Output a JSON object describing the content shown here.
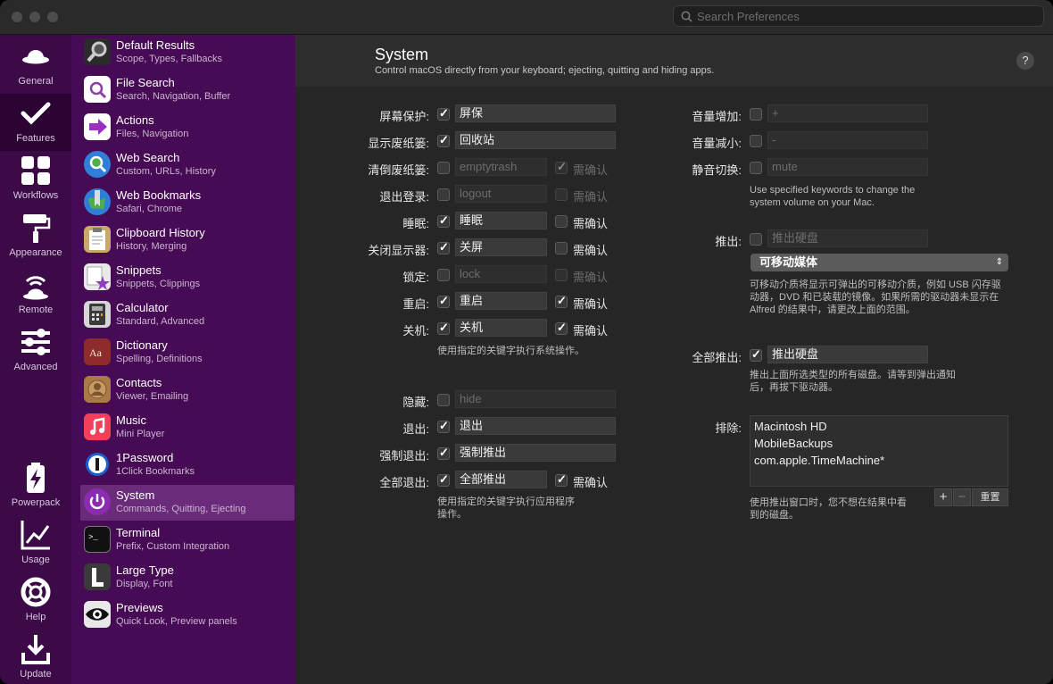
{
  "search": {
    "placeholder": "Search Preferences"
  },
  "leftbar": [
    {
      "label": "General",
      "icon": "hat-icon"
    },
    {
      "label": "Features",
      "icon": "checkmark-icon"
    },
    {
      "label": "Workflows",
      "icon": "grid-icon"
    },
    {
      "label": "Appearance",
      "icon": "paint-roller-icon"
    },
    {
      "label": "Remote",
      "icon": "remote-icon"
    },
    {
      "label": "Advanced",
      "icon": "sliders-icon"
    },
    {
      "label": "Powerpack",
      "icon": "battery-icon"
    },
    {
      "label": "Usage",
      "icon": "chart-icon"
    },
    {
      "label": "Help",
      "icon": "lifebuoy-icon"
    },
    {
      "label": "Update",
      "icon": "download-icon"
    }
  ],
  "features": [
    {
      "title": "Default Results",
      "subtitle": "Scope, Types, Fallbacks",
      "icon": "magnifier-icon"
    },
    {
      "title": "File Search",
      "subtitle": "Search, Navigation, Buffer",
      "icon": "file-search-icon"
    },
    {
      "title": "Actions",
      "subtitle": "Files, Navigation",
      "icon": "actions-arrow-icon"
    },
    {
      "title": "Web Search",
      "subtitle": "Custom, URLs, History",
      "icon": "globe-search-icon"
    },
    {
      "title": "Web Bookmarks",
      "subtitle": "Safari, Chrome",
      "icon": "globe-bookmark-icon"
    },
    {
      "title": "Clipboard History",
      "subtitle": "History, Merging",
      "icon": "clipboard-icon"
    },
    {
      "title": "Snippets",
      "subtitle": "Snippets, Clippings",
      "icon": "snippets-icon"
    },
    {
      "title": "Calculator",
      "subtitle": "Standard, Advanced",
      "icon": "calculator-icon"
    },
    {
      "title": "Dictionary",
      "subtitle": "Spelling, Definitions",
      "icon": "dictionary-icon"
    },
    {
      "title": "Contacts",
      "subtitle": "Viewer, Emailing",
      "icon": "contacts-icon"
    },
    {
      "title": "Music",
      "subtitle": "Mini Player",
      "icon": "music-icon"
    },
    {
      "title": "1Password",
      "subtitle": "1Click Bookmarks",
      "icon": "1password-icon"
    },
    {
      "title": "System",
      "subtitle": "Commands, Quitting, Ejecting",
      "icon": "power-icon"
    },
    {
      "title": "Terminal",
      "subtitle": "Prefix, Custom Integration",
      "icon": "terminal-icon"
    },
    {
      "title": "Large Type",
      "subtitle": "Display, Font",
      "icon": "large-type-icon"
    },
    {
      "title": "Previews",
      "subtitle": "Quick Look, Preview panels",
      "icon": "eye-icon"
    }
  ],
  "header": {
    "title": "System",
    "subtitle": "Control macOS directly from your keyboard; ejecting, quitting and hiding apps."
  },
  "confirm_label": "需确认",
  "system_rows": [
    {
      "label": "屏幕保护:",
      "checked": true,
      "value": "屏保",
      "confirm": null
    },
    {
      "label": "显示废纸篓:",
      "checked": true,
      "value": "回收站",
      "confirm": null
    },
    {
      "label": "清倒废纸篓:",
      "checked": false,
      "value": "emptytrash",
      "confirm": true
    },
    {
      "label": "退出登录:",
      "checked": false,
      "value": "logout",
      "confirm": false
    },
    {
      "label": "睡眠:",
      "checked": true,
      "value": "睡眠",
      "confirm": false
    },
    {
      "label": "关闭显示器:",
      "checked": true,
      "value": "关屏",
      "confirm": false
    },
    {
      "label": "锁定:",
      "checked": false,
      "value": "lock",
      "confirm": false
    },
    {
      "label": "重启:",
      "checked": true,
      "value": "重启",
      "confirm": true
    },
    {
      "label": "关机:",
      "checked": true,
      "value": "关机",
      "confirm": true
    }
  ],
  "system_note": "使用指定的关键字执行系统操作。",
  "app_rows": [
    {
      "label": "隐藏:",
      "checked": false,
      "value": "hide",
      "confirm": null
    },
    {
      "label": "退出:",
      "checked": true,
      "value": "退出",
      "confirm": null
    },
    {
      "label": "强制退出:",
      "checked": true,
      "value": "强制推出",
      "confirm": null
    },
    {
      "label": "全部退出:",
      "checked": true,
      "value": "全部推出",
      "confirm": true
    }
  ],
  "app_note": [
    "使用指定的关键字执行应用程序",
    "操作。"
  ],
  "volume_rows": [
    {
      "label": "音量增加:",
      "checked": false,
      "value": "+"
    },
    {
      "label": "音量减小:",
      "checked": false,
      "value": "-"
    },
    {
      "label": "静音切换:",
      "checked": false,
      "value": "mute"
    }
  ],
  "volume_note": [
    "Use specified keywords to change the",
    "system volume on your Mac."
  ],
  "eject": {
    "label": "推出:",
    "checked": false,
    "value": "推出硬盘",
    "popup": "可移动媒体",
    "note": [
      "可移动介质将显示可弹出的可移动介质，例如 USB 闪存驱",
      "动器，DVD 和已装载的镜像。如果所需的驱动器未显示在",
      "Alfred 的结果中，请更改上面的范围。"
    ]
  },
  "eject_all": {
    "label": "全部推出:",
    "checked": true,
    "value": "推出硬盘",
    "note": [
      "推出上面所选类型的所有磁盘。请等到弹出通知",
      "后，再拔下驱动器。"
    ]
  },
  "exclude": {
    "label": "排除:",
    "items": [
      "Macintosh HD",
      "MobileBackups",
      "com.apple.TimeMachine*"
    ],
    "add": "+",
    "remove": "−",
    "reset": "重置",
    "note": [
      "使用推出窗口时，您不想在结果中看",
      "到的磁盘。"
    ]
  }
}
